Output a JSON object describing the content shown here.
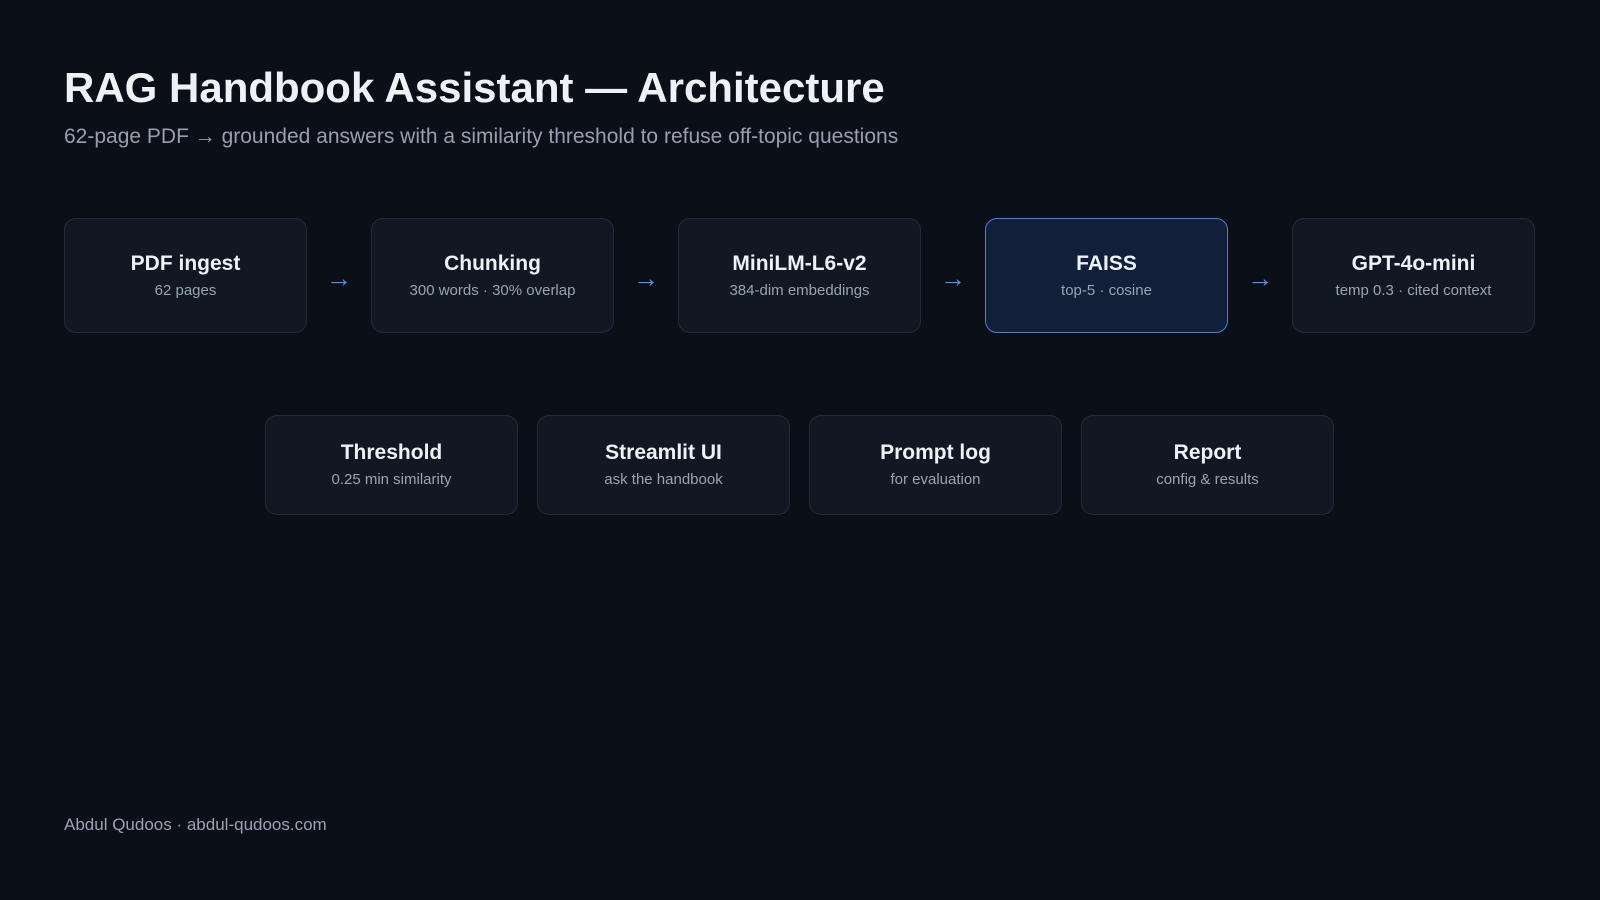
{
  "header": {
    "title": "RAG Handbook Assistant — Architecture",
    "subtitle": "62-page PDF → grounded answers with a similarity threshold to refuse off-topic questions"
  },
  "pipeline": {
    "arrow": "→",
    "nodes": [
      {
        "title": "PDF ingest",
        "subtitle": "62 pages"
      },
      {
        "title": "Chunking",
        "subtitle": "300 words · 30% overlap"
      },
      {
        "title": "MiniLM-L6-v2",
        "subtitle": "384-dim embeddings"
      },
      {
        "title": "FAISS",
        "subtitle": "top-5 · cosine",
        "highlighted": true
      },
      {
        "title": "GPT-4o-mini",
        "subtitle": "temp 0.3 · cited context"
      }
    ]
  },
  "components": [
    {
      "title": "Threshold",
      "subtitle": "0.25 min similarity"
    },
    {
      "title": "Streamlit UI",
      "subtitle": "ask the handbook"
    },
    {
      "title": "Prompt log",
      "subtitle": "for evaluation"
    },
    {
      "title": "Report",
      "subtitle": "config & results"
    }
  ],
  "footer": {
    "text": "Abdul Qudoos · abdul-qudoos.com"
  },
  "colors": {
    "background": "#0b0f17",
    "card": "#111823",
    "card_border": "#232c3a",
    "highlight_card": "#111f38",
    "highlight_border": "#4a7fe0",
    "arrow": "#5b8def"
  }
}
